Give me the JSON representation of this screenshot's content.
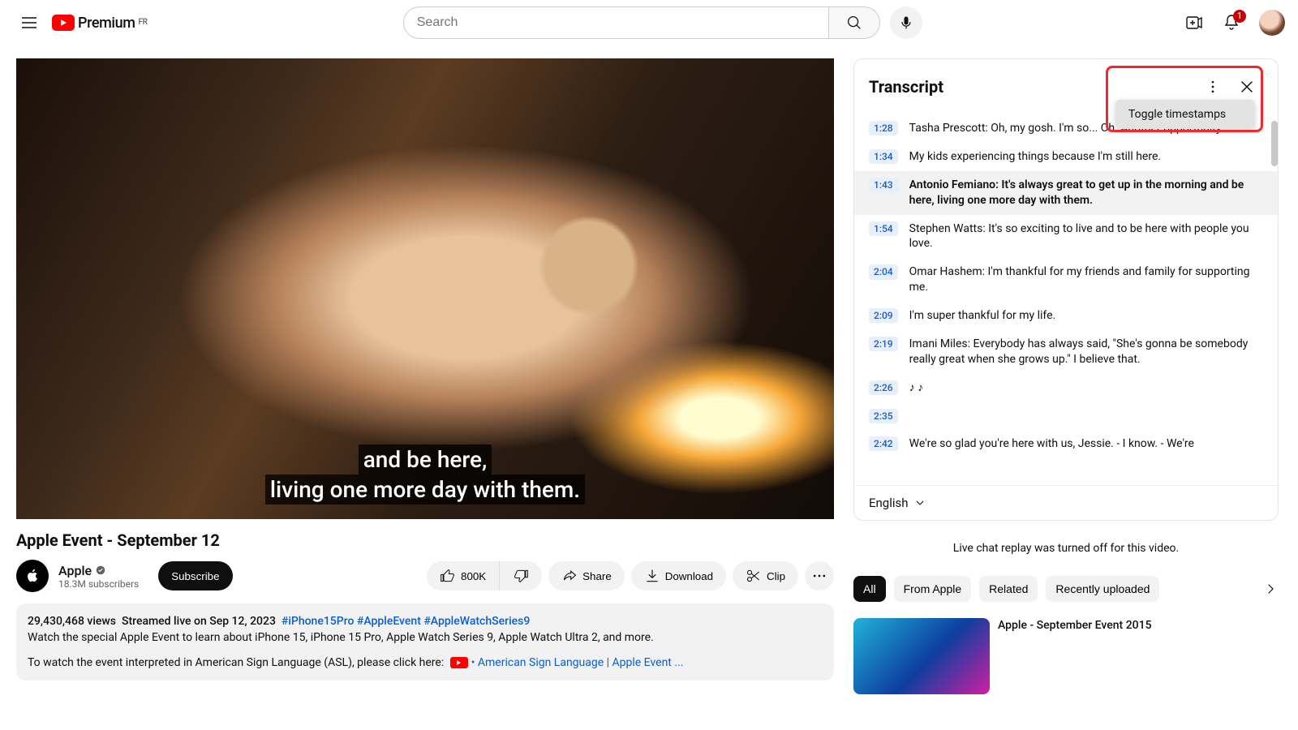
{
  "header": {
    "logo_text": "Premium",
    "country": "FR",
    "search_placeholder": "Search",
    "notification_count": "1"
  },
  "video": {
    "caption_line1": "and be here,",
    "caption_line2": "living one more day with them.",
    "title": "Apple Event - September 12",
    "channel": "Apple",
    "subscribers": "18.3M subscribers",
    "subscribe_label": "Subscribe",
    "like_count": "800K",
    "share_label": "Share",
    "download_label": "Download",
    "clip_label": "Clip"
  },
  "description": {
    "views": "29,430,468 views",
    "streamed": "Streamed live on Sep 12, 2023",
    "hashtags": [
      "#iPhone15Pro",
      "#AppleEvent",
      "#AppleWatchSeries9"
    ],
    "body": "Watch the special Apple Event to learn about iPhone 15, iPhone 15 Pro, Apple Watch Series 9, Apple Watch Ultra 2, and more.",
    "asl_prefix": "To watch the event interpreted in American Sign Language (ASL), please click here:",
    "asl_link": "• American Sign Language | Apple Event ..."
  },
  "transcript": {
    "title": "Transcript",
    "toggle_label": "Toggle timestamps",
    "language": "English",
    "segments": [
      {
        "t": "1:28",
        "text": "Tasha Prescott: Oh, my gosh. I'm so... Oh. Another opportunity."
      },
      {
        "t": "1:34",
        "text": "My kids experiencing things because I'm still here."
      },
      {
        "t": "1:43",
        "text": "Antonio Femiano: It's always great to get up in the morning and be here, living one more day with them.",
        "active": true
      },
      {
        "t": "1:54",
        "text": "Stephen Watts: It's so exciting to live and to be here with people you love."
      },
      {
        "t": "2:04",
        "text": "Omar Hashem: I'm thankful for my friends and family for supporting me."
      },
      {
        "t": "2:09",
        "text": "I'm super thankful for my life."
      },
      {
        "t": "2:19",
        "text": "Imani Miles: Everybody has always said, \"She's gonna be somebody really great when she grows up.\" I believe that."
      },
      {
        "t": "2:26",
        "text": "♪ ♪"
      },
      {
        "t": "2:35",
        "text": ""
      },
      {
        "t": "2:42",
        "text": "We're so glad you're here with us, Jessie. - I know. - We're"
      }
    ]
  },
  "livechat_off": "Live chat replay was turned off for this video.",
  "chips": [
    "All",
    "From Apple",
    "Related",
    "Recently uploaded"
  ],
  "related": {
    "title": "Apple - September Event 2015"
  }
}
